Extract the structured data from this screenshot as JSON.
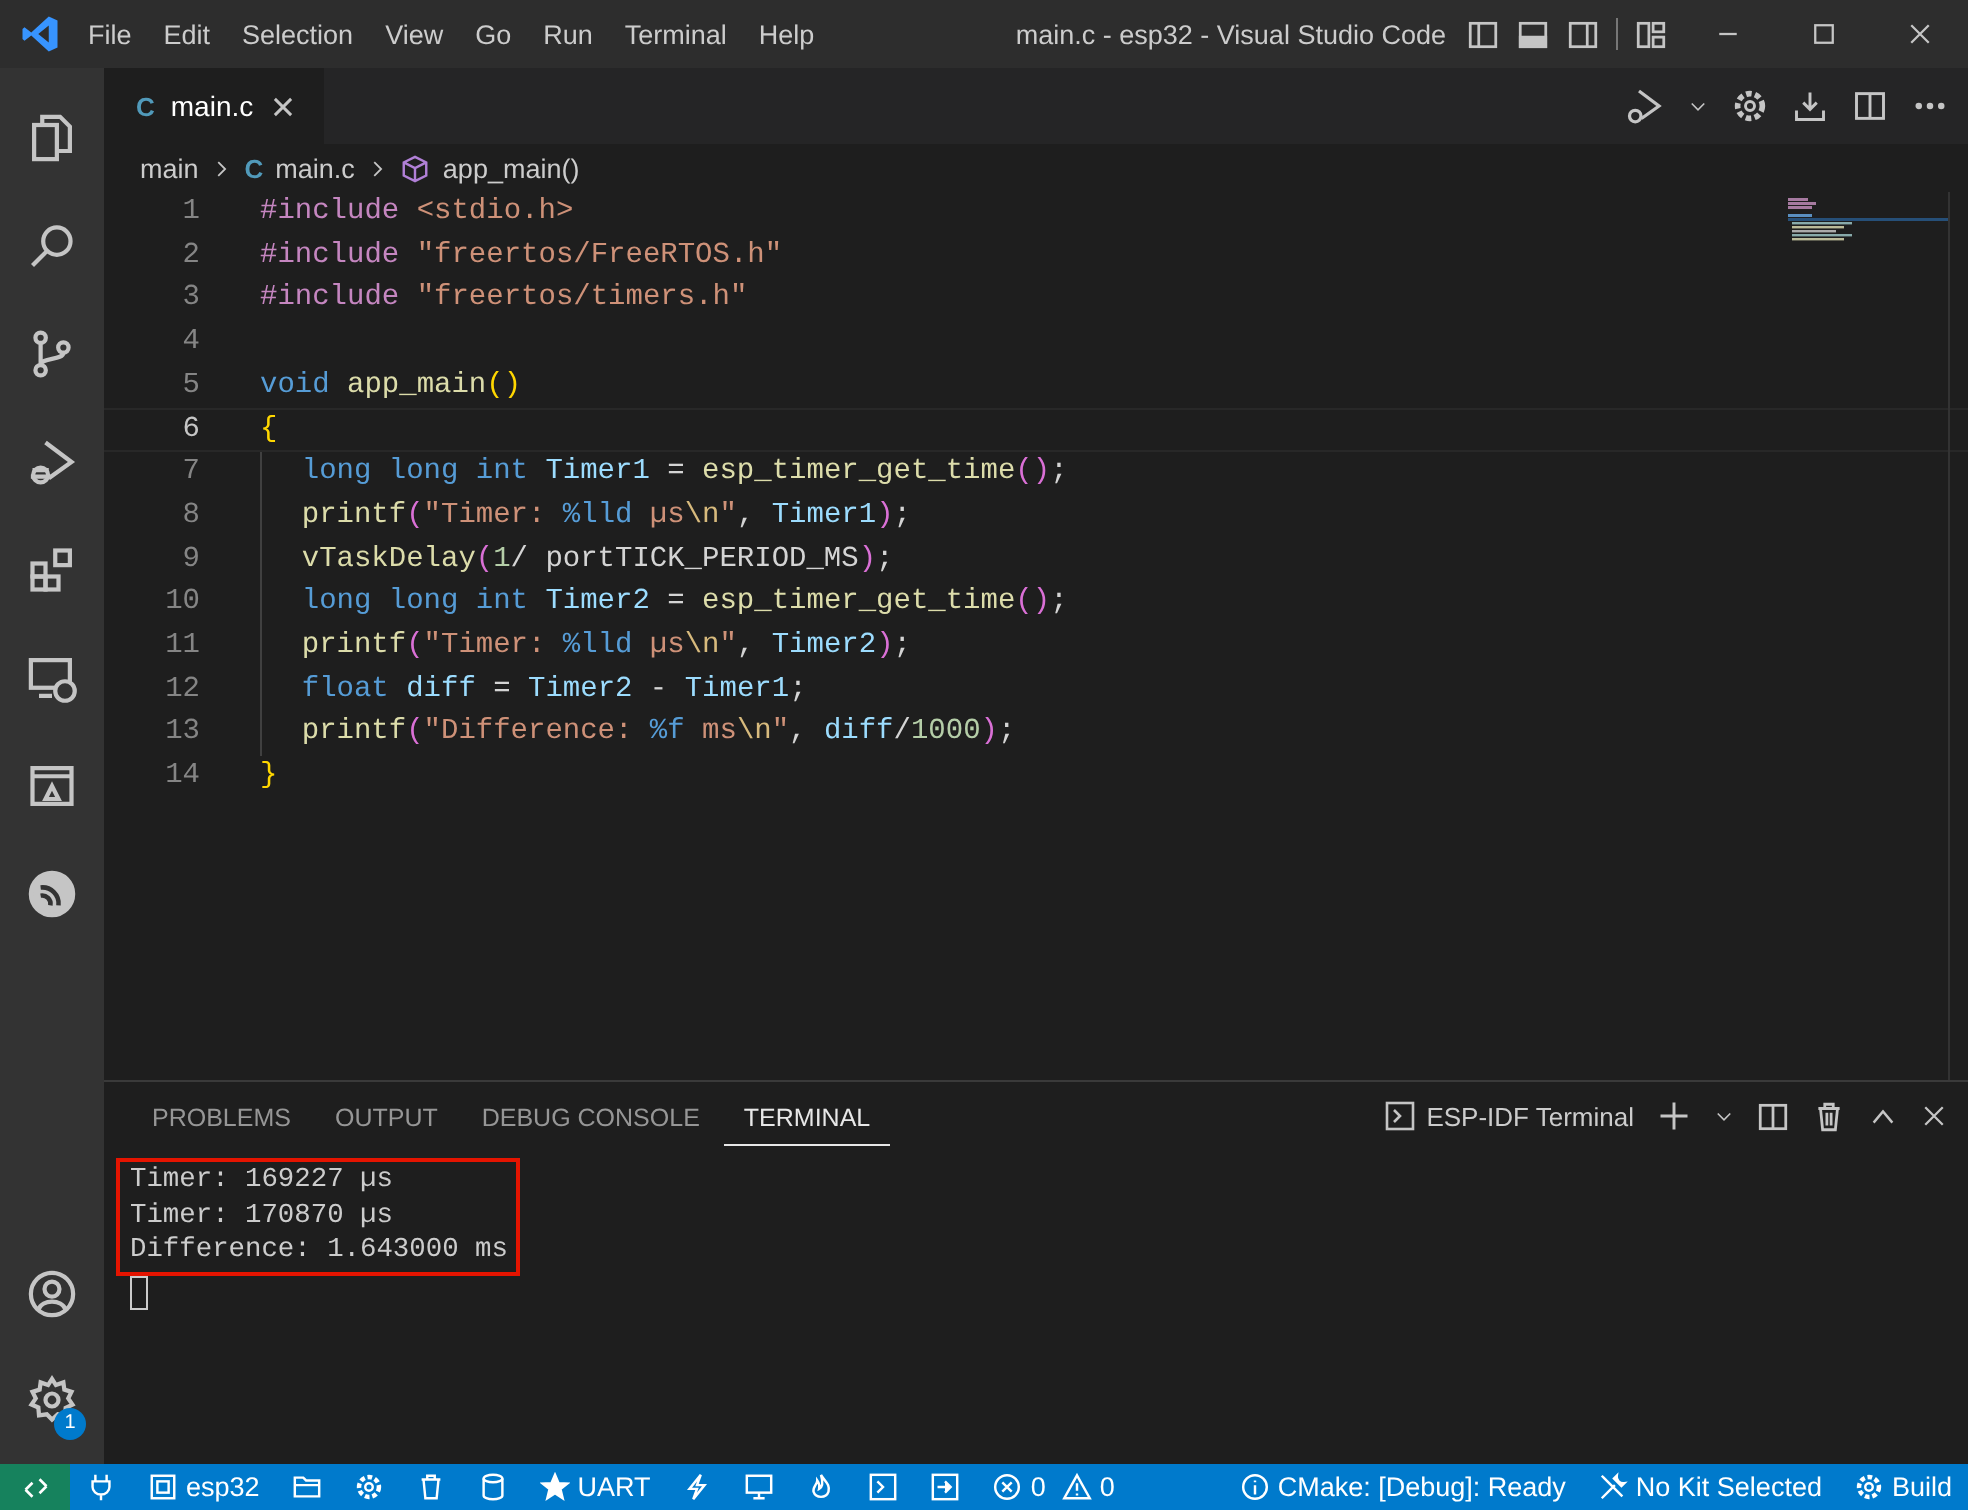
{
  "window": {
    "title": "main.c - esp32 - Visual Studio Code"
  },
  "menu": [
    "File",
    "Edit",
    "Selection",
    "View",
    "Go",
    "Run",
    "Terminal",
    "Help"
  ],
  "activity_bar": {
    "manage_badge": "1"
  },
  "tabs": [
    {
      "label": "main.c",
      "icon_text": "C",
      "selected": true
    }
  ],
  "breadcrumb": [
    {
      "label": "main",
      "kind": "folder"
    },
    {
      "label": "main.c",
      "kind": "file",
      "icon_text": "C"
    },
    {
      "label": "app_main()",
      "kind": "symbol"
    }
  ],
  "editor": {
    "lines": [
      {
        "number": "1",
        "current": false,
        "guide": false,
        "tokens": [
          {
            "kind": "pre",
            "t": "#include "
          },
          {
            "kind": "str",
            "t": "<stdio.h>"
          }
        ]
      },
      {
        "number": "2",
        "current": false,
        "guide": false,
        "tokens": [
          {
            "kind": "pre",
            "t": "#include "
          },
          {
            "kind": "str",
            "t": "\"freertos/FreeRTOS.h\""
          }
        ]
      },
      {
        "number": "3",
        "current": false,
        "guide": false,
        "tokens": [
          {
            "kind": "pre",
            "t": "#include "
          },
          {
            "kind": "str",
            "t": "\"freertos/timers.h\""
          }
        ]
      },
      {
        "number": "4",
        "current": false,
        "guide": false
      },
      {
        "number": "5",
        "current": false,
        "guide": false,
        "tokens": [
          {
            "kind": "kw",
            "t": "void "
          },
          {
            "kind": "fn",
            "t": "app_main"
          },
          {
            "kind": "br1",
            "t": "()"
          }
        ]
      },
      {
        "number": "6",
        "current": true,
        "guide": false,
        "tokens": [
          {
            "kind": "br1",
            "t": "{"
          }
        ]
      },
      {
        "number": "7",
        "current": false,
        "guide": true,
        "tokens": [
          {
            "kind": "kw",
            "t": "long long int "
          },
          {
            "kind": "var",
            "t": "Timer1"
          },
          {
            "kind": "plain",
            "t": " = "
          },
          {
            "kind": "fn",
            "t": "esp_timer_get_time"
          },
          {
            "kind": "br2",
            "t": "()"
          },
          {
            "kind": "plain",
            "t": ";"
          }
        ]
      },
      {
        "number": "8",
        "current": false,
        "guide": true,
        "tokens": [
          {
            "kind": "fn",
            "t": "printf"
          },
          {
            "kind": "br2",
            "t": "("
          },
          {
            "kind": "str",
            "t": "\"Timer: "
          },
          {
            "kind": "fmt",
            "t": "%lld"
          },
          {
            "kind": "str",
            "t": " µs"
          },
          {
            "kind": "esc",
            "t": "\\n"
          },
          {
            "kind": "str",
            "t": "\""
          },
          {
            "kind": "plain",
            "t": ", "
          },
          {
            "kind": "var",
            "t": "Timer1"
          },
          {
            "kind": "br2",
            "t": ")"
          },
          {
            "kind": "plain",
            "t": ";"
          }
        ]
      },
      {
        "number": "9",
        "current": false,
        "guide": true,
        "tokens": [
          {
            "kind": "fn",
            "t": "vTaskDelay"
          },
          {
            "kind": "br2",
            "t": "("
          },
          {
            "kind": "num",
            "t": "1"
          },
          {
            "kind": "plain",
            "t": "/ portTICK_PERIOD_MS"
          },
          {
            "kind": "br2",
            "t": ")"
          },
          {
            "kind": "plain",
            "t": ";"
          }
        ]
      },
      {
        "number": "10",
        "current": false,
        "guide": true,
        "tokens": [
          {
            "kind": "kw",
            "t": "long long int "
          },
          {
            "kind": "var",
            "t": "Timer2"
          },
          {
            "kind": "plain",
            "t": " = "
          },
          {
            "kind": "fn",
            "t": "esp_timer_get_time"
          },
          {
            "kind": "br2",
            "t": "()"
          },
          {
            "kind": "plain",
            "t": ";"
          }
        ]
      },
      {
        "number": "11",
        "current": false,
        "guide": true,
        "tokens": [
          {
            "kind": "fn",
            "t": "printf"
          },
          {
            "kind": "br2",
            "t": "("
          },
          {
            "kind": "str",
            "t": "\"Timer: "
          },
          {
            "kind": "fmt",
            "t": "%lld"
          },
          {
            "kind": "str",
            "t": " µs"
          },
          {
            "kind": "esc",
            "t": "\\n"
          },
          {
            "kind": "str",
            "t": "\""
          },
          {
            "kind": "plain",
            "t": ", "
          },
          {
            "kind": "var",
            "t": "Timer2"
          },
          {
            "kind": "br2",
            "t": ")"
          },
          {
            "kind": "plain",
            "t": ";"
          }
        ]
      },
      {
        "number": "12",
        "current": false,
        "guide": true,
        "tokens": [
          {
            "kind": "kw",
            "t": "float "
          },
          {
            "kind": "var",
            "t": "diff"
          },
          {
            "kind": "plain",
            "t": " = "
          },
          {
            "kind": "var",
            "t": "Timer2"
          },
          {
            "kind": "plain",
            "t": " - "
          },
          {
            "kind": "var",
            "t": "Timer1"
          },
          {
            "kind": "plain",
            "t": ";"
          }
        ]
      },
      {
        "number": "13",
        "current": false,
        "guide": true,
        "tokens": [
          {
            "kind": "fn",
            "t": "printf"
          },
          {
            "kind": "br2",
            "t": "("
          },
          {
            "kind": "str",
            "t": "\"Difference: "
          },
          {
            "kind": "fmt",
            "t": "%f"
          },
          {
            "kind": "str",
            "t": " ms"
          },
          {
            "kind": "esc",
            "t": "\\n"
          },
          {
            "kind": "str",
            "t": "\""
          },
          {
            "kind": "plain",
            "t": ", "
          },
          {
            "kind": "var",
            "t": "diff"
          },
          {
            "kind": "plain",
            "t": "/"
          },
          {
            "kind": "num",
            "t": "1000"
          },
          {
            "kind": "br2",
            "t": ")"
          },
          {
            "kind": "plain",
            "t": ";"
          }
        ]
      },
      {
        "number": "14",
        "current": false,
        "guide": false,
        "tokens": [
          {
            "kind": "br1",
            "t": "}"
          }
        ]
      }
    ]
  },
  "panel": {
    "tabs": [
      {
        "label": "PROBLEMS",
        "selected": false
      },
      {
        "label": "OUTPUT",
        "selected": false
      },
      {
        "label": "DEBUG CONSOLE",
        "selected": false
      },
      {
        "label": "TERMINAL",
        "selected": true
      }
    ],
    "terminal_name": "ESP-IDF Terminal",
    "terminal": {
      "lines": [
        {
          "text": "Timer: 169227 µs",
          "highlighted": true
        },
        {
          "text": "Timer: 170870 µs",
          "highlighted": true
        },
        {
          "text": "Difference: 1.643000 ms",
          "highlighted": true
        }
      ],
      "cursor": true
    }
  },
  "status_bar": [
    {
      "kind": "remote"
    },
    {
      "kind": "plug"
    },
    {
      "kind": "chip",
      "text": "esp32"
    },
    {
      "kind": "folder"
    },
    {
      "kind": "gear"
    },
    {
      "kind": "trash"
    },
    {
      "kind": "cylinder"
    },
    {
      "kind": "star",
      "text": "UART"
    },
    {
      "kind": "bolt"
    },
    {
      "kind": "monitor"
    },
    {
      "kind": "flame"
    },
    {
      "kind": "terminal"
    },
    {
      "kind": "export"
    },
    {
      "kind": "errors",
      "text": "0"
    },
    {
      "kind": "warnings",
      "text": "0"
    },
    {
      "kind": "info",
      "text": "CMake: [Debug]: Ready"
    },
    {
      "kind": "tools",
      "text": "No Kit Selected"
    },
    {
      "kind": "gear",
      "text": "Build"
    }
  ]
}
